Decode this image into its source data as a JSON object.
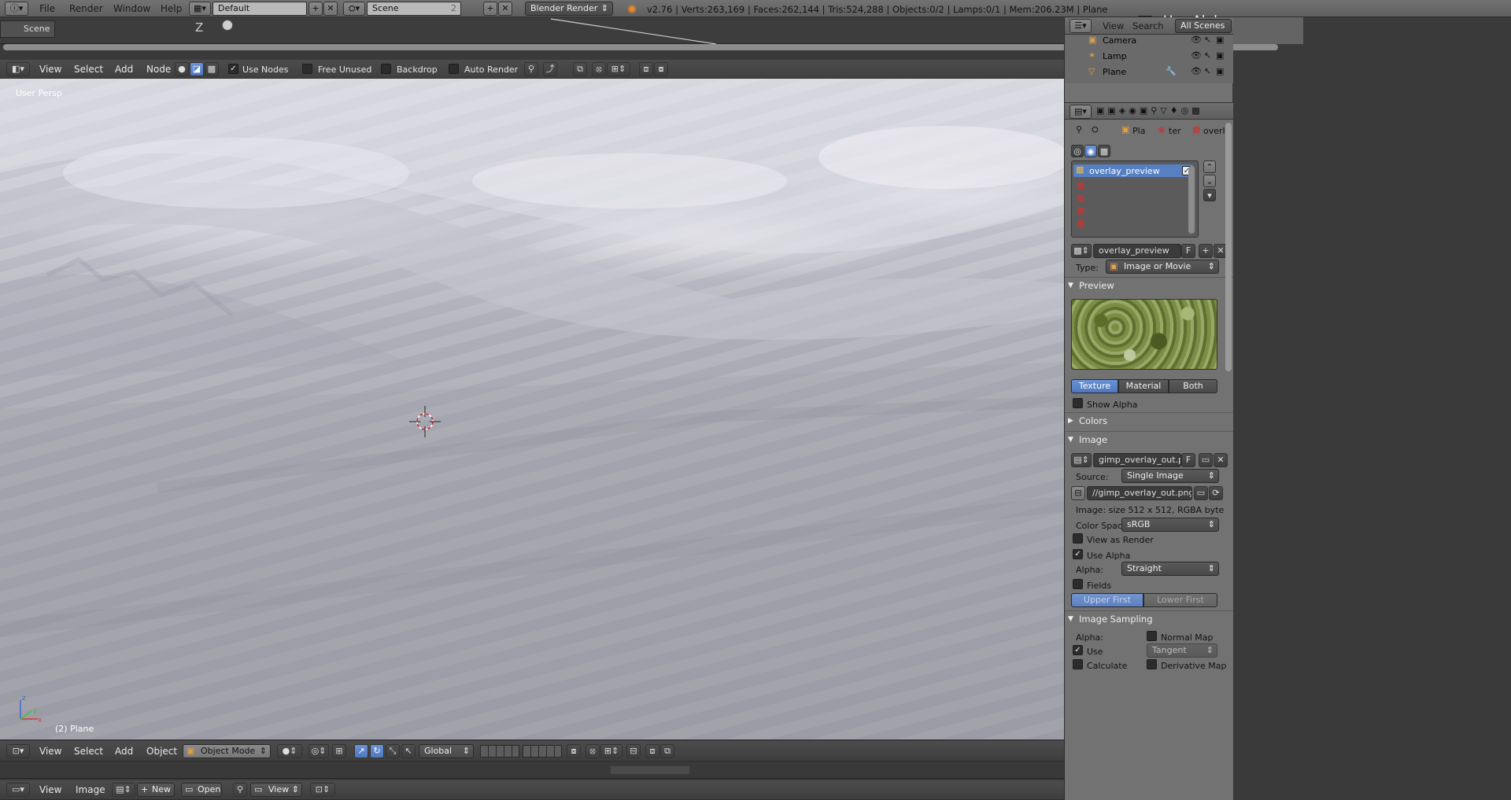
{
  "topbar": {
    "menus": [
      "File",
      "Render",
      "Window",
      "Help"
    ],
    "layout": "Default",
    "scene": "Scene",
    "scene_users": "2",
    "engine": "Blender Render",
    "stats": "v2.76 | Verts:263,169 | Faces:262,144 | Tris:524,288 | Objects:0/2 | Lamps:0/1 | Mem:206.23M | Plane"
  },
  "strip": {
    "scene_tab": "Scene",
    "axis_label": "Z",
    "use_alpha_text": "Use Alpha"
  },
  "node_header": {
    "menus": [
      "View",
      "Select",
      "Add",
      "Node"
    ],
    "checks": [
      {
        "label": "Use Nodes",
        "checked": true
      },
      {
        "label": "Free Unused",
        "checked": false
      },
      {
        "label": "Backdrop",
        "checked": false
      },
      {
        "label": "Auto Render",
        "checked": false
      }
    ]
  },
  "viewport": {
    "view_label": "User Persp",
    "object_label": "(2) Plane",
    "axis": {
      "x": "x",
      "y": "y",
      "z": "z"
    }
  },
  "view3d_header": {
    "menus": [
      "View",
      "Select",
      "Add",
      "Object"
    ],
    "mode": "Object Mode",
    "orientation": "Global"
  },
  "image_header": {
    "menus": [
      "View",
      "Image"
    ],
    "new_label": "New",
    "open_label": "Open",
    "view_label": "View"
  },
  "outliner": {
    "menus": [
      "View",
      "Search"
    ],
    "filter": "All Scenes",
    "items": [
      {
        "name": "Camera",
        "color": "#e0a040"
      },
      {
        "name": "Lamp",
        "color": "#e0a040"
      },
      {
        "name": "Plane",
        "color": "#e0a040"
      }
    ]
  },
  "properties": {
    "breadcrumb": [
      "Pla",
      "ter",
      "overl"
    ],
    "texture_slots": [
      "overlay_preview",
      "",
      "",
      "",
      ""
    ],
    "texture_name": "overlay_preview",
    "fake_user": "F",
    "type_label": "Type:",
    "type_value": "Image or Movie",
    "preview_header": "Preview",
    "preview_tabs": [
      "Texture",
      "Material",
      "Both"
    ],
    "show_alpha": "Show Alpha",
    "colors_header": "Colors",
    "image_header": "Image",
    "image_name": "gimp_overlay_out.png",
    "source_label": "Source:",
    "source_value": "Single Image",
    "filepath": "//gimp_overlay_out.png",
    "image_info": "Image: size 512 x 512, RGBA byte",
    "colorspace_label": "Color Space:",
    "colorspace_value": "sRGB",
    "view_as_render": "View as Render",
    "use_alpha": "Use Alpha",
    "alpha_label": "Alpha:",
    "alpha_value": "Straight",
    "fields": "Fields",
    "field_order": [
      "Upper First",
      "Lower First"
    ],
    "sampling_header": "Image Sampling",
    "sampling_alpha_label": "Alpha:",
    "normal_map": "Normal Map",
    "use_label": "Use",
    "tangent_value": "Tangent",
    "calculate": "Calculate",
    "derivative_map": "Derivative Map"
  }
}
